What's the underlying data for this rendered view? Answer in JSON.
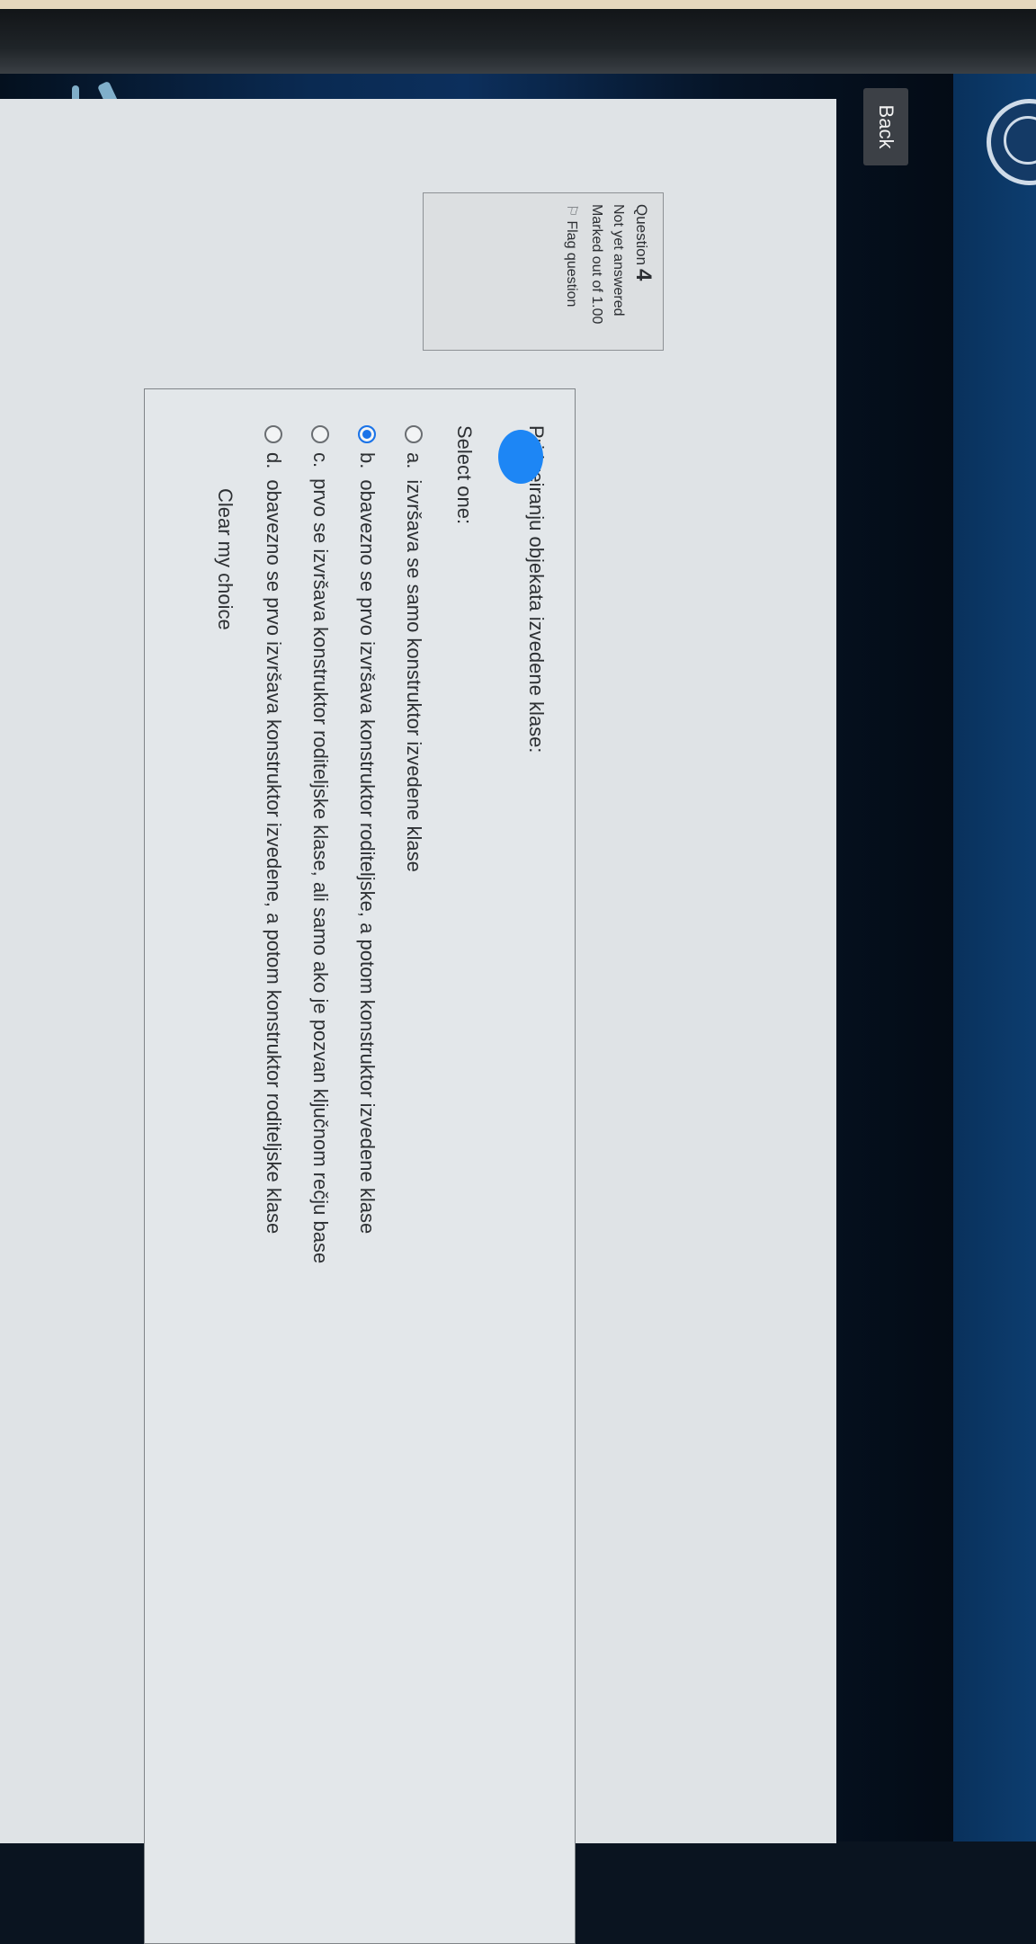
{
  "nav": {
    "back_label": "Back"
  },
  "question_info": {
    "question_label": "Question",
    "question_number": "4",
    "status": "Not yet answered",
    "marked_out_of": "Marked out of 1.00",
    "flag_label": "Flag question"
  },
  "question": {
    "text": "Pri kreiranju objekata izvedene klase:",
    "prompt": "Select one:",
    "options": [
      {
        "letter": "a.",
        "text": "izvršava se samo konstruktor izvedene klase"
      },
      {
        "letter": "b.",
        "text": "obavezno se prvo izvršava konstruktor roditeljske, a potom konstruktor izvedene klase"
      },
      {
        "letter": "c.",
        "text": "prvo se izvršava konstruktor roditeljske klase, ali samo ako je pozvan ključnom rečju base"
      },
      {
        "letter": "d.",
        "text": "obavezno se prvo izvršava konstruktor izvedene, a potom konstruktor roditeljske klase"
      }
    ],
    "selected_option": "b.",
    "clear_label": "Clear my choice"
  },
  "icons": {
    "flag": "flag-icon",
    "radio": "radio-button-icon",
    "logo": "university-seal-logo"
  },
  "colors": {
    "selected_radio": "#1a73e8",
    "back_button": "#3c4046"
  }
}
